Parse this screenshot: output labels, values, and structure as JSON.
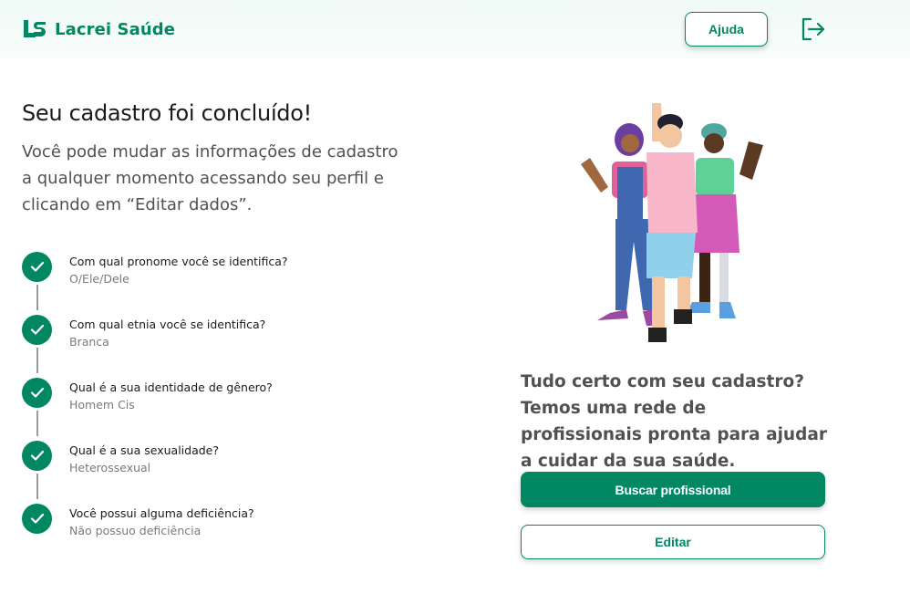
{
  "header": {
    "brand": "Lacrei Saúde",
    "help_label": "Ajuda",
    "logout_icon": "logout-icon"
  },
  "main": {
    "title": "Seu cadastro foi concluído!",
    "lead": "Você pode mudar as informações de cadastro a qualquer momento acessando seu perfil e clicando em “Editar dados”.",
    "steps": [
      {
        "question": "Com qual pronome você se identifica?",
        "answer": "O/Ele/Dele"
      },
      {
        "question": "Com qual etnia você se identifica?",
        "answer": "Branca"
      },
      {
        "question": "Qual é a sua identidade de gênero?",
        "answer": "Homem Cis"
      },
      {
        "question": "Qual é a sua sexualidade?",
        "answer": "Heterossexual"
      },
      {
        "question": "Você possui alguma deficiência?",
        "answer": "Não possuo deficiência"
      }
    ]
  },
  "aside": {
    "message": "Tudo certo com seu cadastro? Temos uma rede de profissionais pronta para ajudar a cuidar da sua saúde.",
    "primary_label": "Buscar profissional",
    "secondary_label": "Editar"
  },
  "colors": {
    "brand": "#018762",
    "text_muted": "#515151",
    "header_bg": "#f0faf6"
  }
}
